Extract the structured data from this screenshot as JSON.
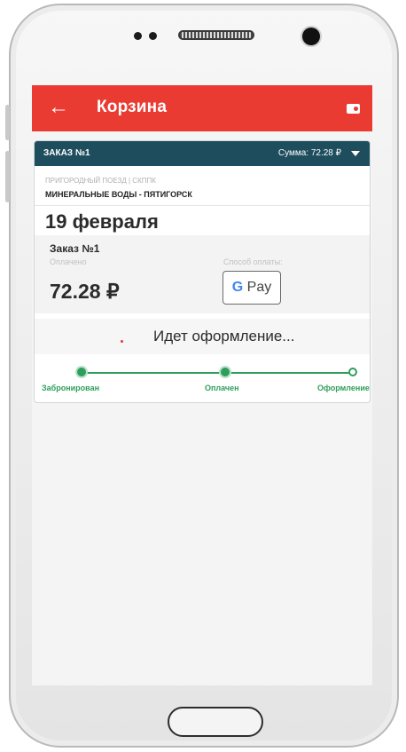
{
  "appbar": {
    "title": "Корзина",
    "back_icon": "arrow-left-icon",
    "wallet_icon": "wallet-icon"
  },
  "order": {
    "header_number": "ЗАКАЗ №1",
    "header_sum": "Сумма: 72.28 ₽",
    "train_type": "ПРИГОРОДНЫЙ ПОЕЗД | СКППК",
    "route": "МИНЕРАЛЬНЫЕ ВОДЫ - ПЯТИГОРСК",
    "date": "19 февраля",
    "payment": {
      "title": "Заказ №1",
      "paid_label": "Оплачено",
      "amount": "72.28 ₽",
      "method_label": "Способ оплаты:",
      "method_g": "G",
      "method_pay": " Pay"
    },
    "status_text": "Идет оформление...",
    "steps": [
      {
        "label": "Забронирован",
        "state": "done"
      },
      {
        "label": "Оплачен",
        "state": "done"
      },
      {
        "label": "Оформление",
        "state": "current"
      }
    ]
  },
  "colors": {
    "primary": "#ea3b33",
    "header": "#1e4d5d",
    "success": "#2e9e5b"
  }
}
